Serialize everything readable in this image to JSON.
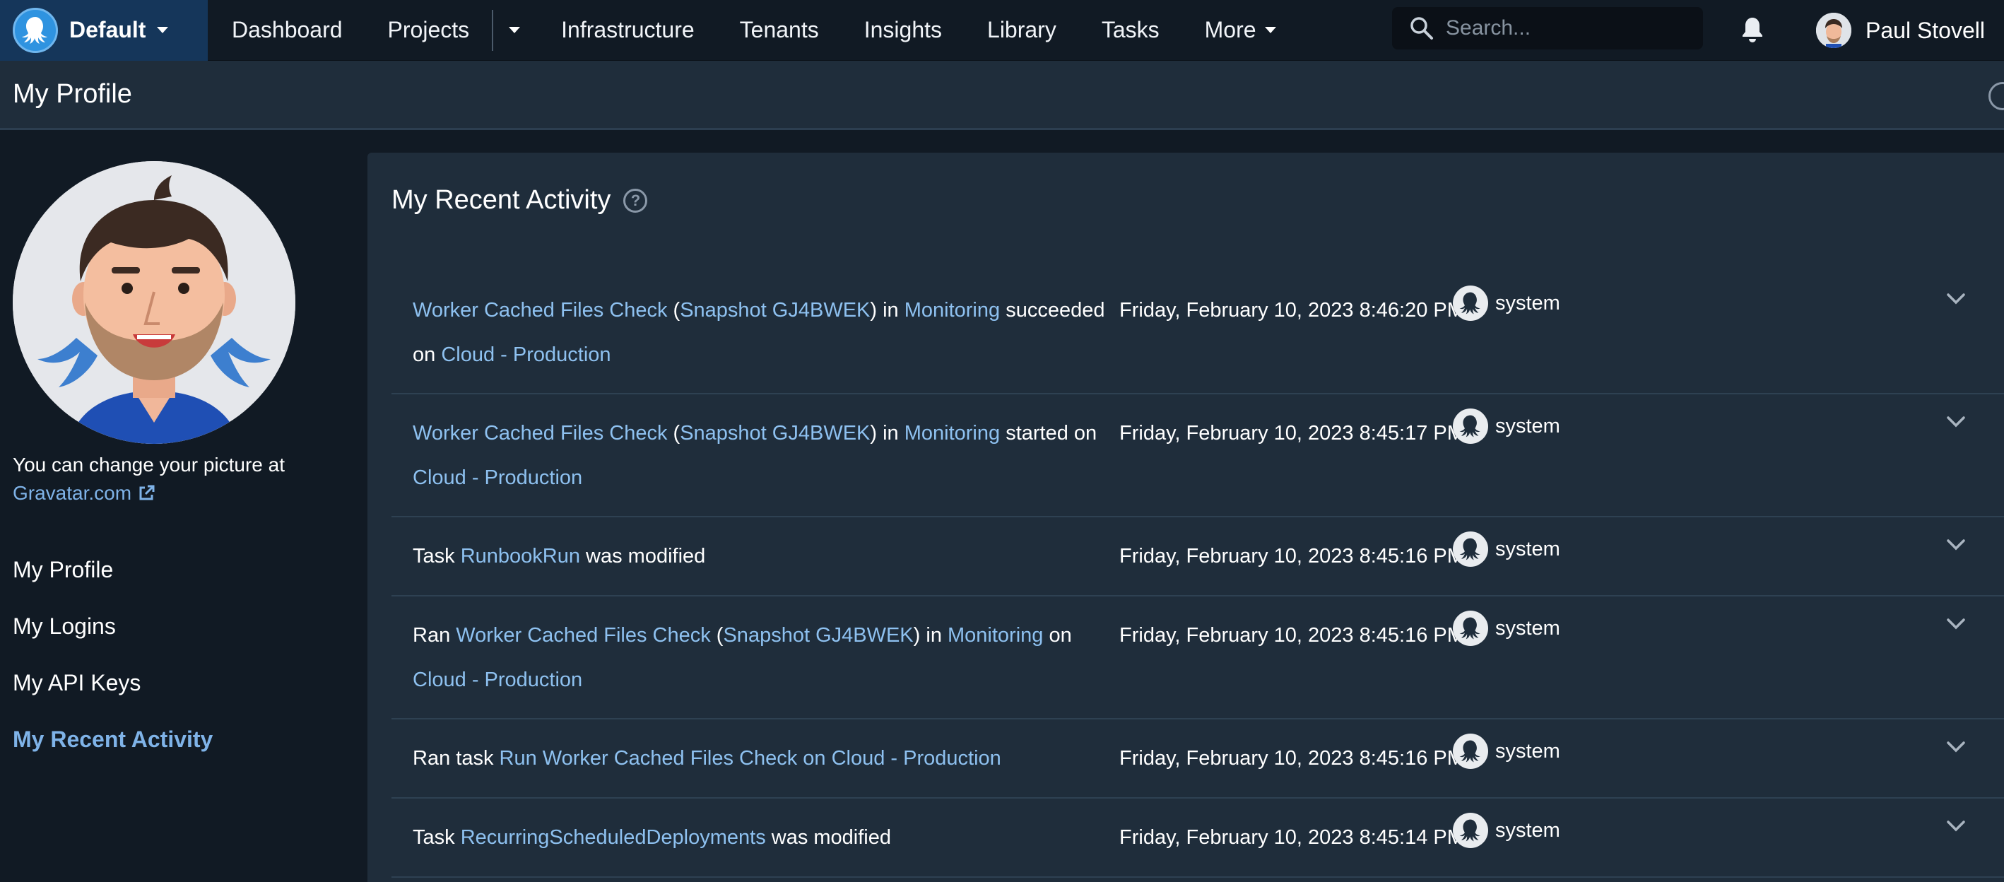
{
  "topbar": {
    "space_name": "Default",
    "nav": [
      "Dashboard",
      "Projects",
      "Infrastructure",
      "Tenants",
      "Insights",
      "Library",
      "Tasks"
    ],
    "more_label": "More",
    "search_placeholder": "Search...",
    "user_name": "Paul Stovell"
  },
  "page": {
    "title": "My Profile"
  },
  "sidebar": {
    "picture_note": "You can change your picture at",
    "gravatar_link": "Gravatar.com",
    "items": [
      {
        "label": "My Profile",
        "active": false
      },
      {
        "label": "My Logins",
        "active": false
      },
      {
        "label": "My API Keys",
        "active": false
      },
      {
        "label": "My Recent Activity",
        "active": true
      }
    ]
  },
  "activity": {
    "title": "My Recent Activity",
    "rows": [
      {
        "segments": [
          {
            "text": "Worker Cached Files Check",
            "link": true
          },
          {
            "text": " (",
            "link": false
          },
          {
            "text": "Snapshot GJ4BWEK",
            "link": true
          },
          {
            "text": ") in ",
            "link": false
          },
          {
            "text": "Monitoring",
            "link": true
          },
          {
            "text": " succeeded on ",
            "link": false
          },
          {
            "text": "Cloud - Production",
            "link": true
          }
        ],
        "date": "Friday, February 10, 2023 8:46:20 PM",
        "user": "system"
      },
      {
        "segments": [
          {
            "text": "Worker Cached Files Check",
            "link": true
          },
          {
            "text": " (",
            "link": false
          },
          {
            "text": "Snapshot GJ4BWEK",
            "link": true
          },
          {
            "text": ") in ",
            "link": false
          },
          {
            "text": "Monitoring",
            "link": true
          },
          {
            "text": " started on ",
            "link": false
          },
          {
            "text": "Cloud - Production",
            "link": true
          }
        ],
        "date": "Friday, February 10, 2023 8:45:17 PM",
        "user": "system"
      },
      {
        "segments": [
          {
            "text": "Task ",
            "link": false
          },
          {
            "text": "RunbookRun",
            "link": true
          },
          {
            "text": " was modified",
            "link": false
          }
        ],
        "date": "Friday, February 10, 2023 8:45:16 PM",
        "user": "system"
      },
      {
        "segments": [
          {
            "text": "Ran ",
            "link": false
          },
          {
            "text": "Worker Cached Files Check",
            "link": true
          },
          {
            "text": " (",
            "link": false
          },
          {
            "text": "Snapshot GJ4BWEK",
            "link": true
          },
          {
            "text": ") in ",
            "link": false
          },
          {
            "text": "Monitoring",
            "link": true
          },
          {
            "text": " on ",
            "link": false
          },
          {
            "text": "Cloud - Production",
            "link": true
          }
        ],
        "date": "Friday, February 10, 2023 8:45:16 PM",
        "user": "system"
      },
      {
        "segments": [
          {
            "text": "Ran task ",
            "link": false
          },
          {
            "text": "Run Worker Cached Files Check on Cloud - Production",
            "link": true
          }
        ],
        "date": "Friday, February 10, 2023 8:45:16 PM",
        "user": "system"
      },
      {
        "segments": [
          {
            "text": "Task ",
            "link": false
          },
          {
            "text": "RecurringScheduledDeployments",
            "link": true
          },
          {
            "text": " was modified",
            "link": false
          }
        ],
        "date": "Friday, February 10, 2023 8:45:14 PM",
        "user": "system"
      }
    ]
  },
  "colors": {
    "accent_link": "#8ec1f0",
    "space_bg": "#15365a",
    "panel_bg": "#1f2d3b",
    "page_bg": "#111a24"
  },
  "icons": {
    "space": "octopus-logo-icon",
    "search": "search-icon",
    "bell": "bell-icon",
    "help": "help-circle-icon",
    "external": "external-link-icon",
    "system_user": "octopus-avatar-icon",
    "expand": "chevron-down-icon"
  }
}
